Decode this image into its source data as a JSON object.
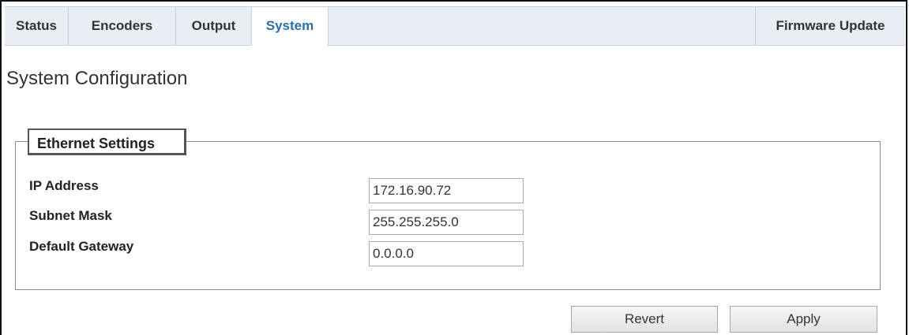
{
  "tabs": [
    {
      "label": "Status"
    },
    {
      "label": "Encoders"
    },
    {
      "label": "Output"
    },
    {
      "label": "System",
      "active": true
    },
    {
      "label": "Firmware Update"
    }
  ],
  "page": {
    "title": "System Configuration"
  },
  "ethernet": {
    "legend": "Ethernet Settings",
    "ip_label": "IP Address",
    "ip_value": "172.16.90.72",
    "subnet_label": "Subnet Mask",
    "subnet_value": "255.255.255.0",
    "gateway_label": "Default Gateway",
    "gateway_value": "0.0.0.0"
  },
  "actions": {
    "revert_label": "Revert",
    "apply_label": "Apply"
  },
  "colors": {
    "active_tab": "#2a6fa8",
    "tabbar_bg": "#e9eef5"
  }
}
